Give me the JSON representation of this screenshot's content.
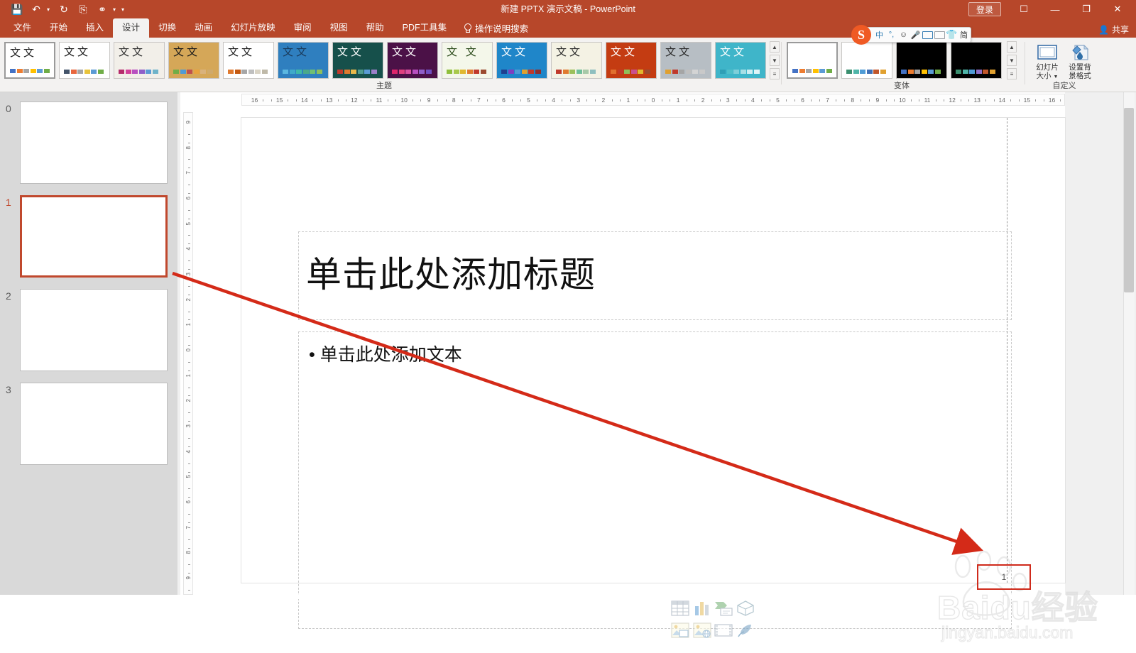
{
  "window": {
    "title": "新建 PPTX 演示文稿  -  PowerPoint",
    "signin_label": "登录",
    "ribbon_display_icon": "ribbon-display-options-icon",
    "minimize_icon": "minimize-icon",
    "restore_icon": "restore-icon",
    "close_icon": "close-icon",
    "share_label": "共享",
    "accent_color": "#b7472a"
  },
  "quick_access": [
    {
      "name": "save-icon",
      "glyph": "💾"
    },
    {
      "name": "undo-icon",
      "glyph": "↶"
    },
    {
      "name": "undo-dropdown-icon",
      "glyph": "▾"
    },
    {
      "name": "redo-icon",
      "glyph": "↻"
    },
    {
      "name": "start-slideshow-icon",
      "glyph": "▶"
    },
    {
      "name": "touch-mode-icon",
      "glyph": "◑"
    },
    {
      "name": "touch-mode-dropdown-icon",
      "glyph": "▾"
    },
    {
      "name": "customize-qat-icon",
      "glyph": "▾"
    }
  ],
  "tabs": [
    {
      "label": "文件",
      "active": false
    },
    {
      "label": "开始",
      "active": false
    },
    {
      "label": "插入",
      "active": false
    },
    {
      "label": "设计",
      "active": true
    },
    {
      "label": "切换",
      "active": false
    },
    {
      "label": "动画",
      "active": false
    },
    {
      "label": "幻灯片放映",
      "active": false
    },
    {
      "label": "审阅",
      "active": false
    },
    {
      "label": "视图",
      "active": false
    },
    {
      "label": "帮助",
      "active": false
    },
    {
      "label": "PDF工具集",
      "active": false
    }
  ],
  "tell_me": {
    "label": "操作说明搜索",
    "icon": "lightbulb-icon"
  },
  "ime": {
    "brand": "S",
    "items": [
      {
        "name": "ime-chinese-mode",
        "glyph": "中"
      },
      {
        "name": "ime-punctuation",
        "glyph": "°,"
      },
      {
        "name": "ime-emoji-icon",
        "glyph": "☺"
      },
      {
        "name": "ime-voice-input-icon",
        "glyph": "Ἲ4"
      },
      {
        "name": "ime-soft-keyboard-icon",
        "glyph": "keyboard"
      },
      {
        "name": "ime-toolbox-icon",
        "glyph": "toolbox"
      },
      {
        "name": "ime-skin-icon",
        "glyph": "T"
      },
      {
        "name": "ime-simplified-mode",
        "glyph": "简"
      },
      {
        "name": "ime-menu-icon",
        "glyph": "grid"
      }
    ]
  },
  "ribbon": {
    "groups": [
      {
        "name": "themes",
        "label": "主题"
      },
      {
        "name": "variants",
        "label": "变体"
      },
      {
        "name": "customize",
        "label": "自定义"
      }
    ],
    "themes": [
      {
        "id": "office-theme",
        "selected": true,
        "bg": "#ffffff",
        "text": "文文",
        "text_color": "#1a1a1a",
        "swatches": [
          "#4472c4",
          "#ed7d31",
          "#a5a5a5",
          "#ffc000",
          "#5b9bd5",
          "#70ad47"
        ]
      },
      {
        "id": "theme-2",
        "selected": false,
        "bg": "#ffffff",
        "text": "文文",
        "text_color": "#1a1a1a",
        "swatches": [
          "#44546a",
          "#e8663d",
          "#a5a5a5",
          "#e8c33a",
          "#5b9bd5",
          "#70ad47"
        ]
      },
      {
        "id": "theme-berlin",
        "selected": false,
        "bg": "#f2efe9",
        "text": "文文",
        "text_color": "#303030",
        "swatches": [
          "#b52b6b",
          "#d2409a",
          "#b84fc0",
          "#8f5fc8",
          "#5b9bd5",
          "#6fb3c9"
        ]
      },
      {
        "id": "theme-wood",
        "selected": false,
        "bg": "#d5a758",
        "text": "文文",
        "text_color": "#1a1a1a",
        "swatches": [
          "#70ad47",
          "#4f9bd5",
          "#c0504d",
          "#e8a33d",
          "#d9b27c",
          "#cfa96b"
        ]
      },
      {
        "id": "theme-ion",
        "selected": false,
        "bg": "#ffffff",
        "text": "文文",
        "text_color": "#1a1a1a",
        "swatches": [
          "#e07a2f",
          "#c55a11",
          "#a6a6a6",
          "#bfbfbf",
          "#d9d3c4",
          "#bfb9a8"
        ]
      },
      {
        "id": "theme-quilt",
        "selected": false,
        "bg": "#2f7fbf",
        "text": "文文",
        "text_color": "#1a3a5a",
        "swatches": [
          "#5bb7e0",
          "#3fa9c9",
          "#3fb8a8",
          "#4aa88a",
          "#6fbf73",
          "#8fbf5a"
        ]
      },
      {
        "id": "theme-facet",
        "selected": false,
        "bg": "#16504b",
        "text": "文文",
        "text_color": "#ffffff",
        "swatches": [
          "#c0392b",
          "#e07a2f",
          "#e8b84a",
          "#4f9b8f",
          "#5b9bd5",
          "#9b7fc9"
        ]
      },
      {
        "id": "theme-violet",
        "selected": false,
        "bg": "#4b1147",
        "text": "文文",
        "text_color": "#ffffff",
        "swatches": [
          "#e0246b",
          "#e0407f",
          "#d94fa0",
          "#b84fc0",
          "#8f5fc8",
          "#6f4fc0"
        ]
      },
      {
        "id": "theme-leaf",
        "selected": false,
        "bg": "#f4f7ea",
        "text": "文 文",
        "text_color": "#2a4a1a",
        "swatches": [
          "#8fbf3a",
          "#a8c94a",
          "#e0b82f",
          "#e07a2f",
          "#c0392b",
          "#9b4a2f"
        ]
      },
      {
        "id": "theme-blue",
        "selected": false,
        "bg": "#1f86c9",
        "text": "文文",
        "text_color": "#ffffff",
        "swatches": [
          "#1f3f8f",
          "#7f3fbf",
          "#4f9bd5",
          "#e0a02f",
          "#c0392b",
          "#8f2f2f"
        ]
      },
      {
        "id": "theme-ivory",
        "selected": false,
        "bg": "#f4f2e4",
        "text": "文文",
        "text_color": "#2a2a2a",
        "swatches": [
          "#c0392b",
          "#e07a2f",
          "#9bbf5a",
          "#6fbf9a",
          "#a8c9a8",
          "#8fbfbf"
        ]
      },
      {
        "id": "theme-red",
        "selected": false,
        "bg": "#c43c12",
        "text": "文文",
        "text_color": "#ffffff",
        "swatches": [
          "#e0702f",
          "#c0392b",
          "#8fbf5a",
          "#c94f8f",
          "#e0b82f",
          "#9b4a2f"
        ]
      },
      {
        "id": "theme-gray",
        "selected": false,
        "bg": "#b7bec4",
        "text": "文文",
        "text_color": "#2a2a2a",
        "swatches": [
          "#e0a02f",
          "#c0392b",
          "#a5a5a5",
          "#bfbfbf",
          "#d4d4d4",
          "#c9c9c9"
        ]
      },
      {
        "id": "theme-teal",
        "selected": false,
        "bg": "#3fb5c9",
        "text": "文文",
        "text_color": "#ffffff",
        "swatches": [
          "#2f9fb5",
          "#4fbfc9",
          "#7fcfd9",
          "#a8dfe5",
          "#cfeef2",
          "#e0f4f7"
        ]
      }
    ],
    "variants": [
      {
        "id": "variant-1",
        "selected": true,
        "bg": "#ffffff",
        "swatches": [
          "#4472c4",
          "#ed7d31",
          "#a5a5a5",
          "#ffc000",
          "#5b9bd5",
          "#70ad47"
        ]
      },
      {
        "id": "variant-2",
        "selected": false,
        "bg": "#ffffff",
        "swatches": [
          "#3a8f6f",
          "#4fb5a8",
          "#4f9bd5",
          "#3f6fb5",
          "#c0562b",
          "#e0a02f"
        ]
      },
      {
        "id": "variant-3",
        "selected": false,
        "bg": "#000000",
        "swatches": [
          "#4472c4",
          "#ed7d31",
          "#a5a5a5",
          "#ffc000",
          "#5b9bd5",
          "#70ad47"
        ]
      },
      {
        "id": "variant-4",
        "selected": false,
        "bg": "#000000",
        "swatches": [
          "#3a8f6f",
          "#4fb5a8",
          "#4f9bd5",
          "#8f6fc8",
          "#c0562b",
          "#e0a02f"
        ]
      }
    ],
    "customize_buttons": [
      {
        "name": "slide-size-button",
        "label_line1": "幻灯片",
        "label_line2": "大小",
        "has_dropdown": true,
        "icon": "slide-size-icon"
      },
      {
        "name": "format-background-button",
        "label_line1": "设置背",
        "label_line2": "景格式",
        "has_dropdown": false,
        "icon": "format-background-icon"
      }
    ],
    "scroll_buttons": [
      {
        "name": "gallery-scroll-up",
        "glyph": "▲"
      },
      {
        "name": "gallery-scroll-down",
        "glyph": "▼"
      },
      {
        "name": "gallery-more",
        "glyph": "☰"
      }
    ]
  },
  "slide_panel": {
    "slides": [
      {
        "number": "0",
        "selected": false
      },
      {
        "number": "1",
        "selected": true
      },
      {
        "number": "2",
        "selected": false
      },
      {
        "number": "3",
        "selected": false
      }
    ]
  },
  "rulers": {
    "horizontal": [
      "16",
      "15",
      "14",
      "13",
      "12",
      "11",
      "10",
      "9",
      "8",
      "7",
      "6",
      "5",
      "4",
      "3",
      "2",
      "1",
      "0",
      "1",
      "2",
      "3",
      "4",
      "5",
      "6",
      "7",
      "8",
      "9",
      "10",
      "11",
      "12",
      "13",
      "14",
      "15",
      "16"
    ],
    "vertical": [
      "9",
      "8",
      "7",
      "6",
      "5",
      "4",
      "3",
      "2",
      "1",
      "0",
      "1",
      "2",
      "3",
      "4",
      "5",
      "6",
      "7",
      "8",
      "9"
    ]
  },
  "slide": {
    "title_placeholder": "单击此处添加标题",
    "body_placeholder": "单击此处添加文本",
    "bullet_char": "•",
    "page_number": "1",
    "content_icons": [
      {
        "name": "insert-table-icon"
      },
      {
        "name": "insert-chart-icon"
      },
      {
        "name": "insert-smartart-icon"
      },
      {
        "name": "insert-3d-model-icon"
      },
      {
        "name": "insert-picture-icon"
      },
      {
        "name": "insert-online-picture-icon"
      },
      {
        "name": "insert-video-icon"
      },
      {
        "name": "insert-icons-icon"
      }
    ]
  },
  "annotation": {
    "color": "#d42a18",
    "arrow_label": "red-arrow-annotation",
    "highlight_label": "page-number-highlight"
  },
  "watermark": {
    "line1": "Baidu经验",
    "line2": "jingyan.baidu.com"
  }
}
